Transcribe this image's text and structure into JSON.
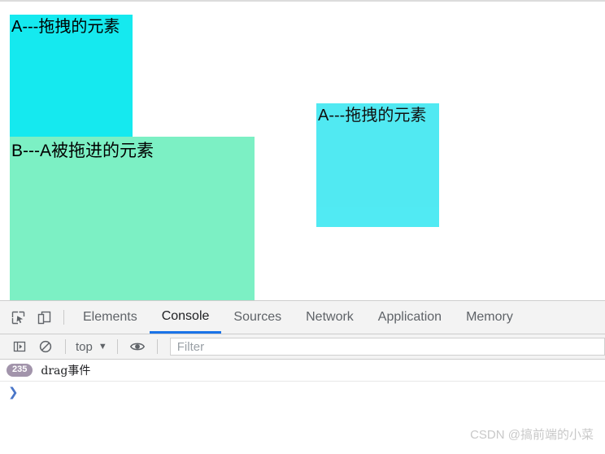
{
  "page": {
    "drag_source": {
      "label": "A---拖拽的元素",
      "color": "#15e9ef"
    },
    "drop_target": {
      "label": "B---A被拖进的元素",
      "color": "#7cf0c4"
    },
    "drag_ghost": {
      "label": "A---拖拽的元素",
      "color": "#44e8f2"
    }
  },
  "devtools": {
    "toolbar_icons": [
      {
        "name": "inspect-element-icon"
      },
      {
        "name": "device-toolbar-icon"
      }
    ],
    "tabs": [
      {
        "label": "Elements",
        "active": false
      },
      {
        "label": "Console",
        "active": true
      },
      {
        "label": "Sources",
        "active": false
      },
      {
        "label": "Network",
        "active": false
      },
      {
        "label": "Application",
        "active": false
      },
      {
        "label": "Memory",
        "active": false
      }
    ],
    "console_toolbar": {
      "sidebar_toggle": "console-sidebar-icon",
      "clear_console": "clear-console-icon",
      "context_value": "top",
      "caret": "▼",
      "eye_icon": "live-expression-eye-icon",
      "filter_placeholder": "Filter"
    },
    "console": {
      "messages": [
        {
          "repeat_count": "235",
          "text": "drag事件",
          "badge_color": "#a294ab"
        }
      ],
      "prompt": "❯"
    },
    "accent_color": "#1a73e8"
  },
  "watermark": {
    "text": "CSDN @搞前端的小菜"
  }
}
